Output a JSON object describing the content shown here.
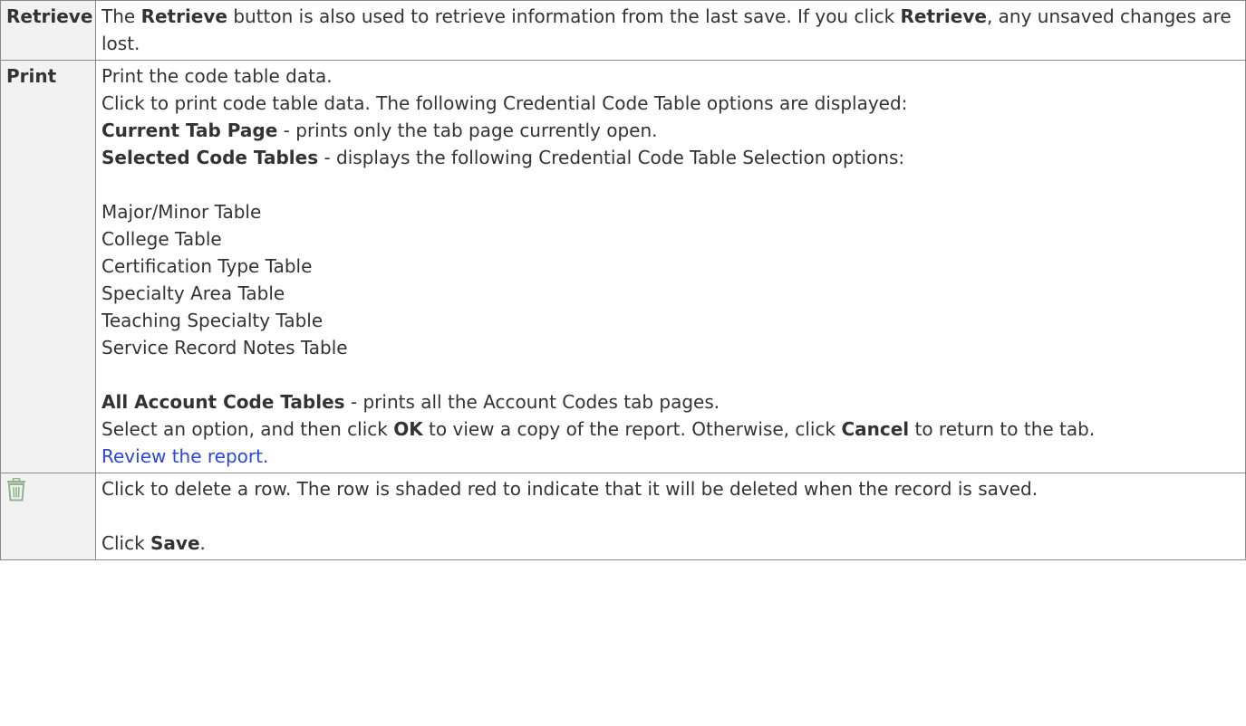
{
  "rows": {
    "retrieve": {
      "key": "Retrieve",
      "t1": "The ",
      "b1": "Retrieve",
      "t2": " button is also used to retrieve information from the last save. If you click ",
      "b2": "Retrieve",
      "t3": ", any unsaved changes are lost."
    },
    "print": {
      "key": "Print",
      "l1": "Print the code table data.",
      "l2": "Click to print code table data. The following Credential Code Table options are displayed:",
      "opt_current_label": "Current Tab Page",
      "opt_current_text": " - prints only the tab page currently open.",
      "opt_selected_label": "Selected Code Tables",
      "opt_selected_text": " - displays the following Credential Code Table Selection options:",
      "tables": [
        "Major/Minor Table",
        "College Table",
        "Certification Type Table",
        "Specialty Area Table",
        "Teaching Specialty Table",
        "Service Record Notes Table"
      ],
      "opt_all_label": "All Account Code Tables",
      "opt_all_text": " - prints all the Account Codes tab pages.",
      "select_t1": "Select an option, and then click ",
      "select_b1": "OK",
      "select_t2": " to view a copy of the report. Otherwise, click ",
      "select_b2": "Cancel",
      "select_t3": " to return to the tab.",
      "review_link": "Review the report."
    },
    "delete": {
      "icon": "trash-icon",
      "icon_color": "#8fb48f",
      "l1": "Click to delete a row. The row is shaded red to indicate that it will be deleted when the record is saved.",
      "save_t1": "Click ",
      "save_b1": "Save",
      "save_t2": "."
    }
  }
}
